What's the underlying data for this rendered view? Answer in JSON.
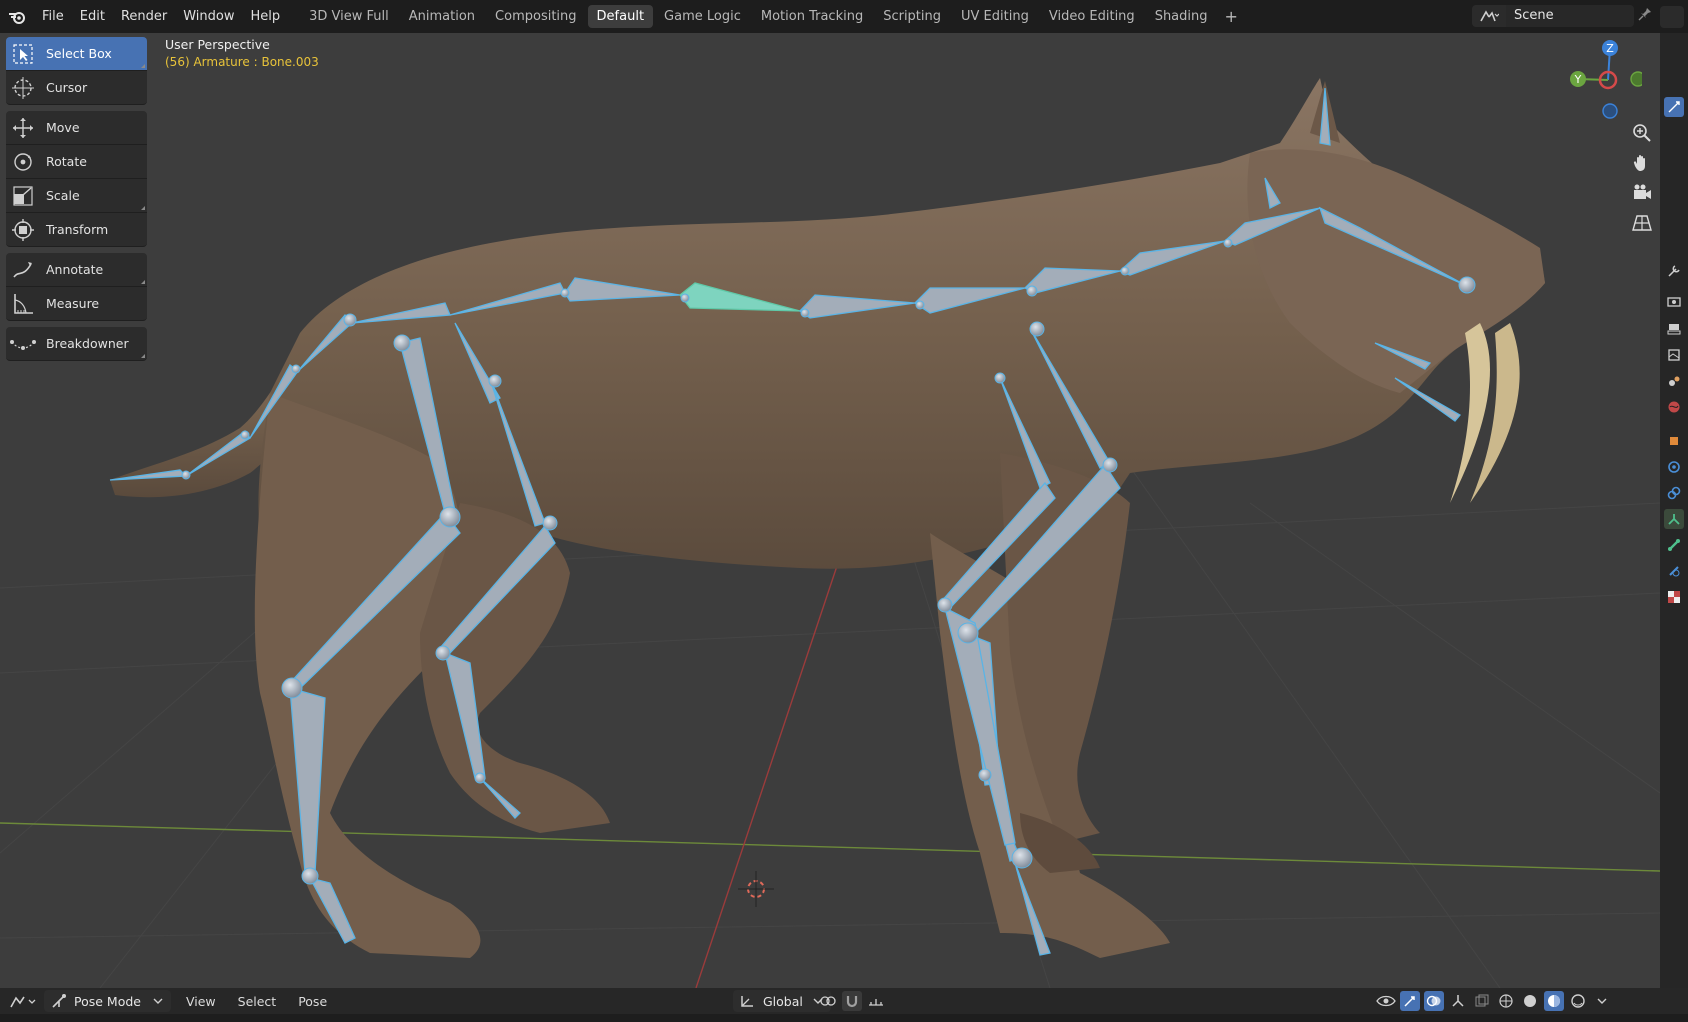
{
  "menu": {
    "items": [
      "File",
      "Edit",
      "Render",
      "Window",
      "Help"
    ]
  },
  "workspaces": {
    "tabs": [
      "3D View Full",
      "Animation",
      "Compositing",
      "Default",
      "Game Logic",
      "Motion Tracking",
      "Scripting",
      "UV Editing",
      "Video Editing",
      "Shading"
    ],
    "active": "Default",
    "add_label": "+"
  },
  "scene": {
    "name": "Scene"
  },
  "tools": {
    "select_box": "Select Box",
    "cursor": "Cursor",
    "move": "Move",
    "rotate": "Rotate",
    "scale": "Scale",
    "transform": "Transform",
    "annotate": "Annotate",
    "measure": "Measure",
    "breakdowner": "Breakdowner"
  },
  "viewport": {
    "view_name": "User Perspective",
    "active_info": "(56) Armature : Bone.003"
  },
  "gizmo": {
    "z": "Z",
    "y": "Y"
  },
  "bottom": {
    "mode": "Pose Mode",
    "view": "View",
    "select": "Select",
    "pose": "Pose",
    "orientation": "Global"
  },
  "colors": {
    "accent": "#4772b3",
    "bone_outline": "#5ab4e6",
    "active_bone": "#5fc9a8",
    "info_text": "#e8c33a"
  }
}
